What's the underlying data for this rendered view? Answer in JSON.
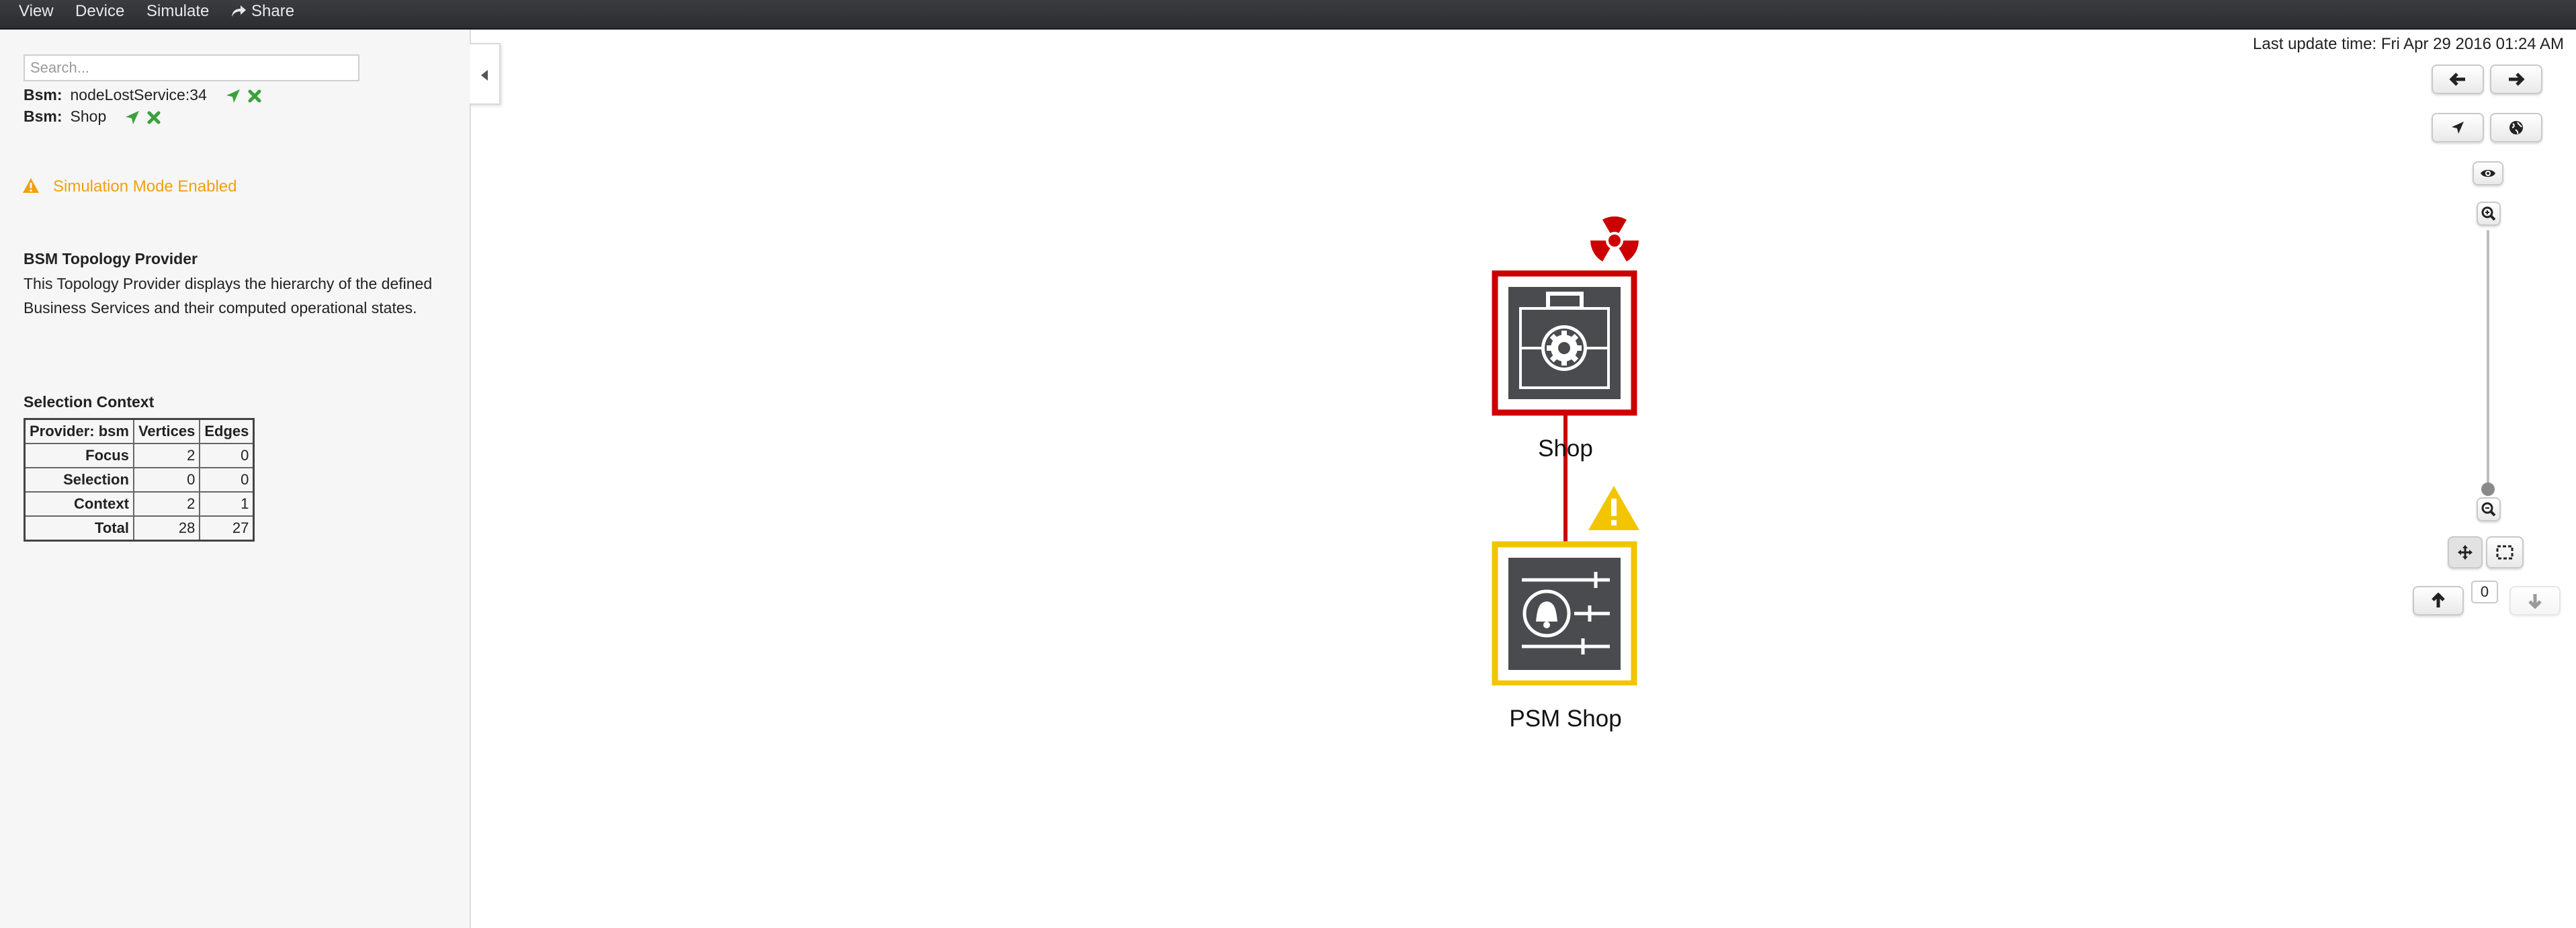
{
  "menu": {
    "view": "View",
    "device": "Device",
    "simulate": "Simulate",
    "share": "Share"
  },
  "search": {
    "placeholder": "Search..."
  },
  "criteria": [
    {
      "key": "Bsm:",
      "value": "nodeLostService:34"
    },
    {
      "key": "Bsm:",
      "value": "Shop"
    }
  ],
  "simulation_notice": "Simulation Mode Enabled",
  "provider_info": {
    "title": "BSM Topology Provider",
    "description": "This Topology Provider displays the hierarchy of the defined Business Services and their computed operational states."
  },
  "selection_context": {
    "title": "Selection Context",
    "headers": [
      "Provider: bsm",
      "Vertices",
      "Edges"
    ],
    "rows": [
      {
        "label": "Focus",
        "vertices": "2",
        "edges": "0"
      },
      {
        "label": "Selection",
        "vertices": "0",
        "edges": "0"
      },
      {
        "label": "Context",
        "vertices": "2",
        "edges": "1"
      },
      {
        "label": "Total",
        "vertices": "28",
        "edges": "27"
      }
    ]
  },
  "last_update": "Last update time: Fri Apr 29 2016 01:24 AM",
  "graph": {
    "nodes": [
      {
        "label": "Shop",
        "status": "critical",
        "status_color": "#cc0000",
        "icon": "briefcase-gear-icon"
      },
      {
        "label": "PSM Shop",
        "status": "warning",
        "status_color": "#f2c500",
        "icon": "alarm-sliders-icon"
      }
    ],
    "edge_color": "#cc0000"
  },
  "semantic_zoom_level": "0",
  "colors": {
    "menubar": "#2f3033",
    "accent_warning": "#f0a10e",
    "critical": "#cc0000",
    "warning": "#f2c500",
    "icon_fill": "#4a4b4e"
  }
}
